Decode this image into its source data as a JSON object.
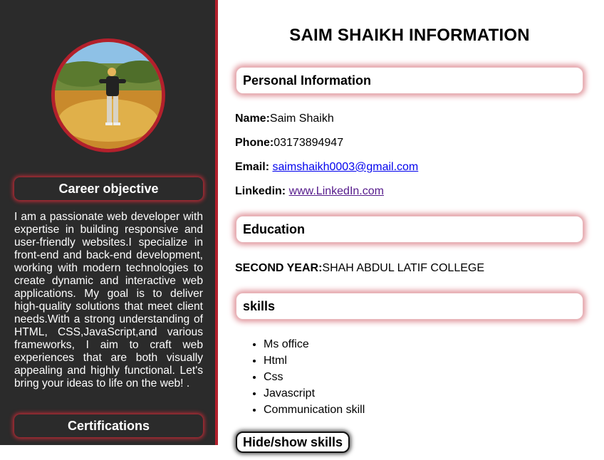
{
  "sidebar": {
    "avatar_alt": "Profile photo",
    "career_heading": "Career objective",
    "career_text": "I am a passionate web developer with expertise in building responsive and user-friendly websites.I specialize in front-end and back-end development, working with modern technologies to create dynamic and interactive web applications. My goal is to deliver high-quality solutions that meet client needs.With a strong understanding of HTML, CSS,JavaScript,and various frameworks, I aim to craft web experiences that are both visually appealing and highly functional. Let's bring your ideas to life on the web! .",
    "certifications_heading": "Certifications"
  },
  "main": {
    "title": "SAIM SHAIKH INFORMATION",
    "personal": {
      "heading": "Personal Information",
      "name_label": "Name:",
      "name_value": "Saim Shaikh",
      "phone_label": "Phone:",
      "phone_value": "03173894947",
      "email_label": "Email:",
      "email_value": "saimshaikh0003@gmail.com",
      "linkedin_label": "Linkedin:",
      "linkedin_value": "www.LinkedIn.com"
    },
    "education": {
      "heading": "Education",
      "level_label": "SECOND YEAR:",
      "level_value": "SHAH ABDUL LATIF COLLEGE"
    },
    "skills": {
      "heading": "skills",
      "items": [
        "Ms office",
        "Html",
        "Css",
        "Javascript",
        "Communication skill"
      ],
      "toggle_label": "Hide/show skills"
    }
  },
  "colors": {
    "sidebar_bg": "#2b2b2b",
    "accent_red": "#b3202c",
    "link": "#0000ee",
    "link_visited": "#551a8b"
  }
}
